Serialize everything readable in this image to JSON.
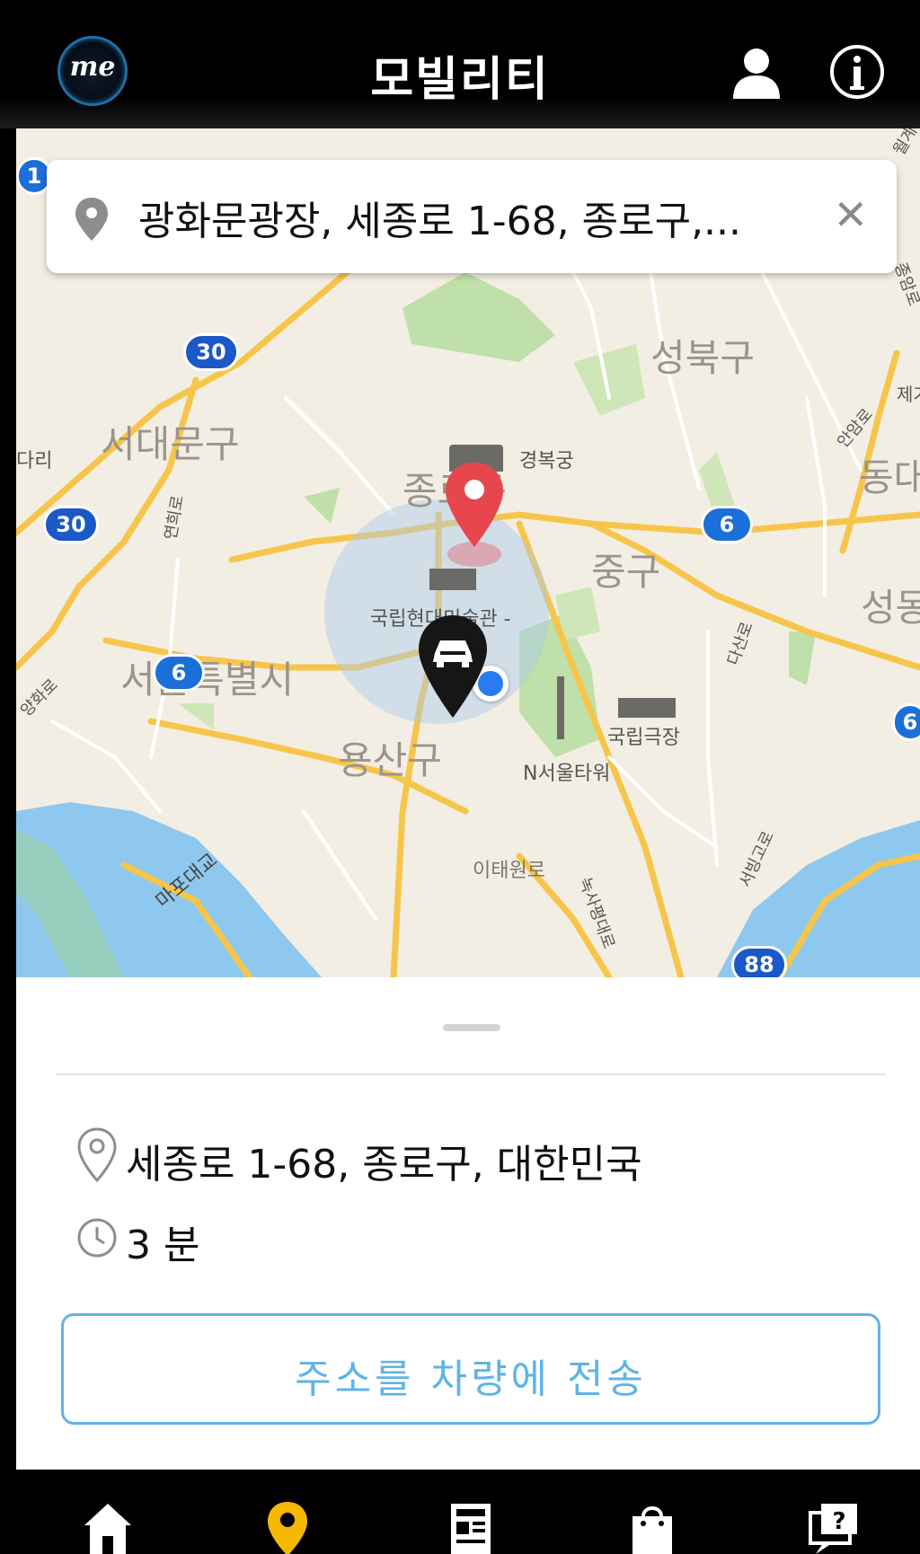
{
  "header": {
    "logo_text": "me",
    "title": "모빌리티",
    "icons": [
      "profile-icon",
      "info-icon"
    ]
  },
  "search": {
    "value": "광화문광장, 세종로 1-68, 종로구,...",
    "icons": [
      "location-pin-icon",
      "close-icon"
    ]
  },
  "map": {
    "labels": {
      "seongbuk": "성북구",
      "seodaemun": "서대문구",
      "jongno": "종로구",
      "jung": "중구",
      "yongsan": "용산구",
      "seoul": "서울특별시",
      "dong": "동대",
      "seongdong": "성동",
      "gyeongbokgung": "경복궁",
      "mmca": "국립현대미술관 -",
      "national_theater": "국립극장",
      "n_tower": "N서울타워",
      "itaewon": "이태원로",
      "mapo_bridge": "마포대교",
      "dari": "다리",
      "yeonhui": "연희로",
      "yanghwa": "양화로",
      "dasan": "다산로",
      "seobinggo": "서빙고로",
      "noksapyeong": "녹사평대로",
      "anam": "안암로",
      "jongam": "종암로",
      "wolgye": "월계",
      "je": "제기"
    },
    "route_badges": [
      "1",
      "30",
      "30",
      "6",
      "6",
      "88",
      "6"
    ]
  },
  "sheet": {
    "address": "세종로 1-68, 종로구, 대한민국",
    "duration": "3 분",
    "cta_label": "주소를 차량에 전송"
  },
  "nav": {
    "items": [
      "home-icon",
      "location-icon",
      "news-icon",
      "shop-icon",
      "help-icon"
    ],
    "active_color": "#f5b800"
  },
  "colors": {
    "accent": "#5fb4e6",
    "pin_red": "#e8464f",
    "badge_blue": "#1b6fd8"
  }
}
